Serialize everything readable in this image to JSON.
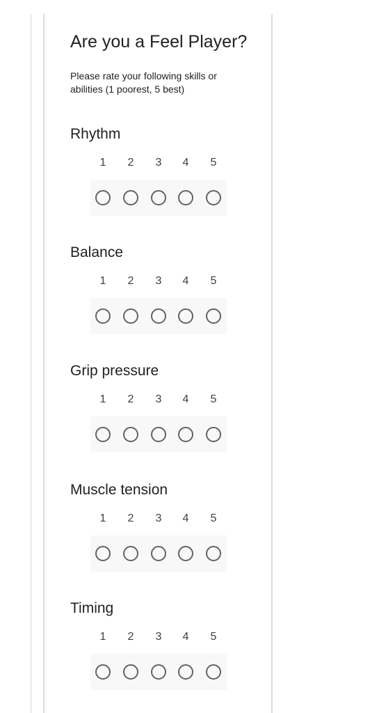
{
  "form": {
    "title": "Are you a Feel Player?",
    "description": "Please rate your following skills or abilities (1 poorest, 5 best)"
  },
  "scale": {
    "values": [
      "1",
      "2",
      "3",
      "4",
      "5"
    ]
  },
  "questions": [
    {
      "label": "Rhythm",
      "selected": null
    },
    {
      "label": "Balance",
      "selected": null
    },
    {
      "label": "Grip pressure",
      "selected": null
    },
    {
      "label": "Muscle tension",
      "selected": null
    },
    {
      "label": "Timing",
      "selected": null
    }
  ],
  "colors": {
    "text": "#202124",
    "radio_border": "#5f6368",
    "scale_background": "#f8f8f8",
    "card_border": "#dadce0"
  }
}
